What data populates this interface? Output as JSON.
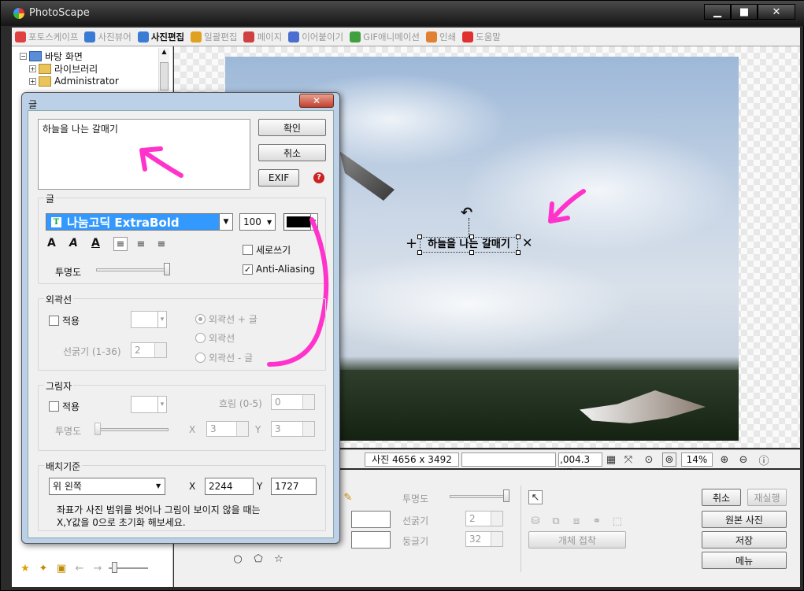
{
  "app": {
    "title": "PhotoScape"
  },
  "window_buttons": {
    "minimize": "▁",
    "maximize": "■",
    "close": "✕"
  },
  "tabs": [
    {
      "label": "포토스케이프",
      "color": "#e04040"
    },
    {
      "label": "사진뷰어",
      "color": "#3a7bd5"
    },
    {
      "label": "사진편집",
      "color": "#3a7bd5",
      "active": true
    },
    {
      "label": "일괄편집",
      "color": "#e0a020"
    },
    {
      "label": "페이지",
      "color": "#d04040"
    },
    {
      "label": "이어붙이기",
      "color": "#4a6fd0"
    },
    {
      "label": "GIF애니메이션",
      "color": "#40a040"
    },
    {
      "label": "인쇄",
      "color": "#e08030"
    },
    {
      "label": "도움말",
      "color": "#e03030"
    }
  ],
  "tree": {
    "items": [
      {
        "label": "바탕 화면",
        "expander": "−"
      },
      {
        "label": "라이브러리",
        "expander": "+"
      },
      {
        "label": "Administrator",
        "expander": "+"
      }
    ]
  },
  "status": {
    "photo_size": "사진 4656 x 3492",
    "file_size": ",004.3 KB",
    "zoom": "14%"
  },
  "canvas_text": "하늘을 나는 갈매기",
  "bottom": {
    "opacity_label": "투명도",
    "thickness_label": "선굵기",
    "thickness_value": "2",
    "roundness_label": "둥글기",
    "roundness_value": "32",
    "attach_label": "개체 접착",
    "cancel": "취소",
    "redo": "재실행",
    "original": "원본 사진",
    "save": "저장",
    "menu": "메뉴"
  },
  "dialog": {
    "title": "글",
    "close": "✕",
    "text_value": "하늘을 나는 갈매기",
    "ok": "확인",
    "cancel": "취소",
    "exif": "EXIF",
    "help": "?",
    "text_section": {
      "label": "글",
      "font_name": "나눔고딕 ExtraBold",
      "font_icon": "T",
      "font_size": "100",
      "color": "#000000",
      "vertical_label": "세로쓰기",
      "vertical_checked": false,
      "aa_label": "Anti-Aliasing",
      "aa_checked": true,
      "opacity_label": "투명도",
      "opacity_level": 1.0,
      "style_bold": "A",
      "style_italic": "A",
      "style_underline": "A"
    },
    "outline_section": {
      "label": "외곽선",
      "apply_label": "적용",
      "width_label": "선굵기 (1-36)",
      "width_value": "2",
      "opt1": "외곽선 + 글",
      "opt2": "외곽선",
      "opt3": "외곽선 - 글"
    },
    "shadow_section": {
      "label": "그림자",
      "apply_label": "적용",
      "blur_label": "흐림 (0-5)",
      "blur_value": "0",
      "opacity_label": "투명도",
      "x_label": "X",
      "x_value": "3",
      "y_label": "Y",
      "y_value": "3"
    },
    "position_section": {
      "label": "배치기준",
      "anchor": "위 왼쪽",
      "x_label": "X",
      "x_value": "2244",
      "y_label": "Y",
      "y_value": "1727",
      "note_line1": "좌표가 사진 범위를 벗어나 그림이 보이지 않을 때는",
      "note_line2": "X,Y값을 0으로 초기화 해보세요."
    }
  }
}
